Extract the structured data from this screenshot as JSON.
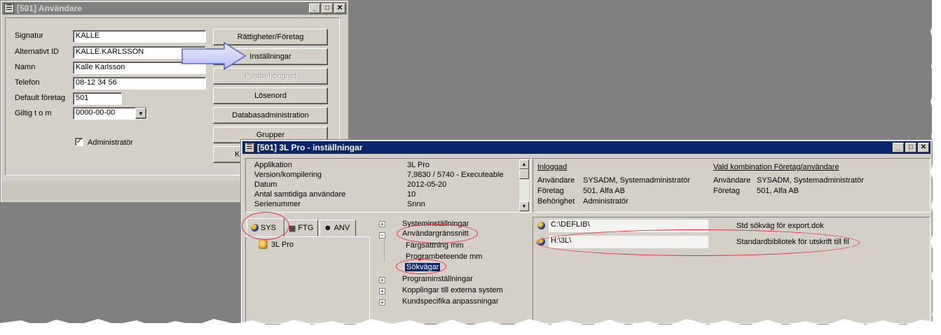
{
  "anvandare_window": {
    "title": "[501] Användare",
    "fields": [
      {
        "label": "Signatur",
        "value": "KALLE"
      },
      {
        "label": "Alternativt ID",
        "value": "KALLE.KARLSSON"
      },
      {
        "label": "Namn",
        "value": "Kalle Karlsson"
      },
      {
        "label": "Telefon",
        "value": "08-12 34 56"
      },
      {
        "label": "Default företag",
        "value": "501"
      },
      {
        "label": "Giltig t o m",
        "value": "0000-00-00"
      }
    ],
    "admin_checkbox": {
      "label": "Administratör",
      "checked": true,
      "mark": "✓"
    },
    "buttons": [
      {
        "label": "Rättigheter/Företag",
        "enabled": true
      },
      {
        "label": "Inställningar",
        "enabled": true
      },
      {
        "label": "Postbehörighet",
        "enabled": false
      },
      {
        "label": "Lösenord",
        "enabled": true
      },
      {
        "label": "Databasadministration",
        "enabled": true
      },
      {
        "label": "Grupper",
        "enabled": true
      },
      {
        "label": "K",
        "enabled": true
      }
    ]
  },
  "installningar_window": {
    "title": "[501]  3L Pro - inställningar",
    "app_info": [
      {
        "key": "Applikation",
        "value": "3L Pro"
      },
      {
        "key": "Version/kompilering",
        "value": "7,9830 / 5740 - Executeable"
      },
      {
        "key": "Datum",
        "value": "2012-05-20"
      },
      {
        "key": "Antal samtidiga användare",
        "value": "10"
      },
      {
        "key": "Serienummer",
        "value": "Snnn"
      }
    ],
    "inloggad": {
      "header": "Inloggad",
      "rows": [
        {
          "key": "Användare",
          "value": "SYSADM, Systemadministratör"
        },
        {
          "key": "Företag",
          "value": "501, Alfa AB"
        },
        {
          "key": "Behörighet",
          "value": "Administratör"
        }
      ]
    },
    "vald_kombination": {
      "header": "Vald kombination Företag/användare",
      "rows": [
        {
          "key": "Användare",
          "value": "SYSADM, Systemadministratör"
        },
        {
          "key": "Företag",
          "value": "501, Alfa AB"
        }
      ]
    },
    "tabs": [
      {
        "label": "SYS",
        "icon": "globe-icon"
      },
      {
        "label": "FTG",
        "icon": "building-icon"
      },
      {
        "label": "ANV",
        "icon": "user-icon"
      }
    ],
    "tab_tree_item": "3L Pro",
    "settings_tree": [
      {
        "label": "Systeminställningar",
        "level": 0,
        "expander": "+"
      },
      {
        "label": "Användargränssnitt",
        "level": 0,
        "expander": "−"
      },
      {
        "label": "Färgsättning mm",
        "level": 1
      },
      {
        "label": "Programbeteende mm",
        "level": 1
      },
      {
        "label": "Sökvägar",
        "level": 1,
        "selected": true
      },
      {
        "label": "Programinställningar",
        "level": 0,
        "expander": "+"
      },
      {
        "label": "Kopplingar till externa system",
        "level": 0,
        "expander": "+"
      },
      {
        "label": "Kundspecifika anpassningar",
        "level": 0,
        "expander": "+"
      }
    ],
    "paths": [
      {
        "path": "C:\\DEFLIB\\",
        "description": "Std sökväg för export.dok"
      },
      {
        "path": "H:\\3L\\",
        "description": "Standardbibliotek för utskrift till fil"
      }
    ]
  },
  "colors": {
    "annotation_ring": "#e0283c",
    "arrow_fill": "#c8ccf8",
    "active_titlebar": "#0a246a",
    "selection": "#0a246a"
  }
}
